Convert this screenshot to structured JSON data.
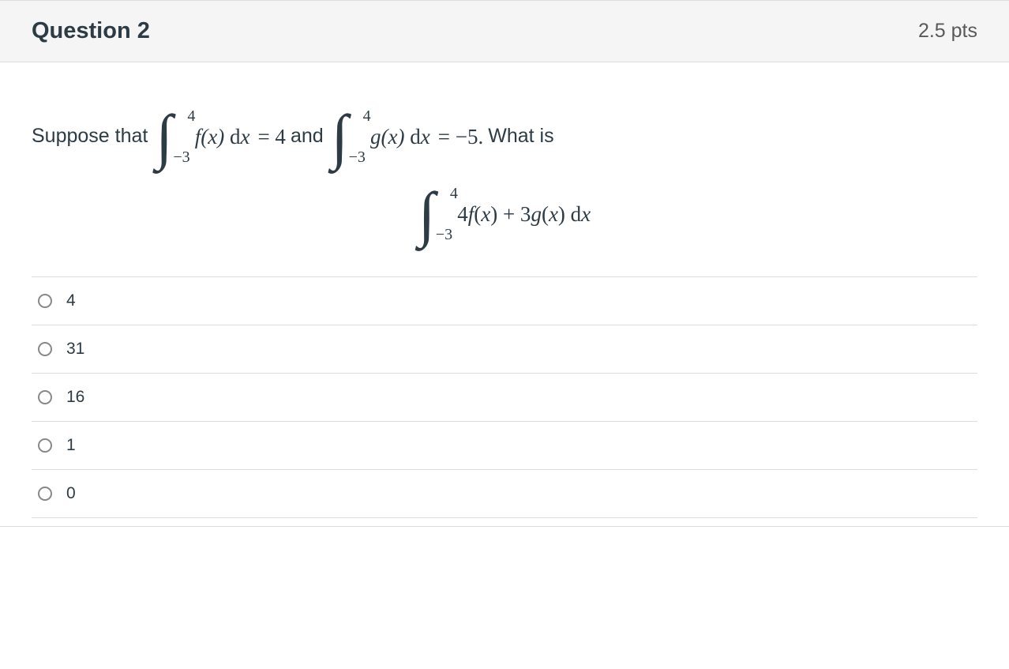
{
  "header": {
    "title": "Question 2",
    "points": "2.5 pts"
  },
  "prompt": {
    "lead": "Suppose that",
    "int1": {
      "upper": "4",
      "lower": "−3",
      "integrand_fn": "f",
      "var": "x",
      "rhs": " = 4"
    },
    "mid": " and",
    "int2": {
      "upper": "4",
      "lower": "−3",
      "integrand_fn": "g",
      "var": "x",
      "rhs": " = −5."
    },
    "tail": "  What is",
    "int3": {
      "upper": "4",
      "lower": "−3",
      "combo": "4f(x) + 3g(x)"
    }
  },
  "answers": [
    {
      "label": "4"
    },
    {
      "label": "31"
    },
    {
      "label": "16"
    },
    {
      "label": "1"
    },
    {
      "label": "0"
    }
  ]
}
